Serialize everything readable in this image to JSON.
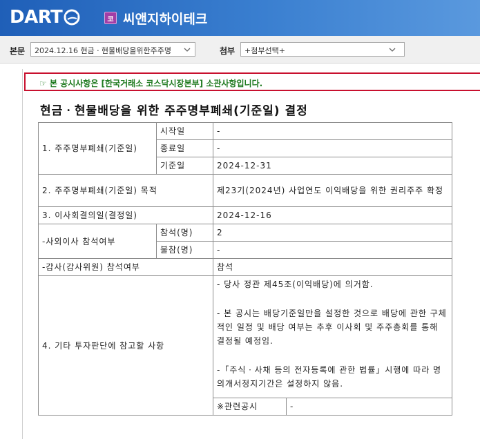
{
  "header": {
    "logo": "DART",
    "company_badge": "코",
    "company_name": "씨앤지하이테크"
  },
  "toolbar": {
    "main_label": "본문",
    "main_select_value": "2024.12.16  현금ㆍ현물배당을위한주주명",
    "attach_label": "첨부",
    "attach_select_value": "+첨부선택+"
  },
  "notice": "☞ 본 공시사항은 [한국거래소 코스닥시장본부] 소관사항입니다.",
  "doc_title": "현금ㆍ현물배당을 위한 주주명부폐쇄(기준일) 결정",
  "table": {
    "r1_label": "1. 주주명부폐쇄(기준일)",
    "r1_start_label": "시작일",
    "r1_start_value": "-",
    "r1_end_label": "종료일",
    "r1_end_value": "-",
    "r1_base_label": "기준일",
    "r1_base_value": "2024-12-31",
    "r2_label": "2. 주주명부폐쇄(기준일) 목적",
    "r2_value": "제23기(2024년) 사업연도 이익배당을 위한 권리주주 확정",
    "r3_label": "3. 이사회결의일(결정일)",
    "r3_value": "2024-12-16",
    "r4_label": "-사외이사 참석여부",
    "r4_present_label": "참석(명)",
    "r4_present_value": "2",
    "r4_absent_label": "불참(명)",
    "r4_absent_value": "-",
    "r5_label": "-감사(감사위원) 참석여부",
    "r5_value": "참석",
    "r6_label": "4. 기타 투자판단에 참고할 사항",
    "r6_line1": "- 당사 정관 제45조(이익배당)에 의거함.",
    "r6_line2": "- 본 공시는 배당기준일만을 설정한 것으로 배당에 관한 구체적인 일정 및 배당 여부는 추후 이사회 및 주주총회를 통해 결정될 예정임.",
    "r6_line3": "-「주식ㆍ사채 등의 전자등록에 관한 법률」시행에 따라 명의개서정지기간은 설정하지 않음.",
    "related_label": "※관련공시",
    "related_value": "-"
  },
  "colors": {
    "header_blue": "#1f5fb8",
    "notice_border": "#c8102e",
    "notice_text": "#1f7a1f"
  }
}
